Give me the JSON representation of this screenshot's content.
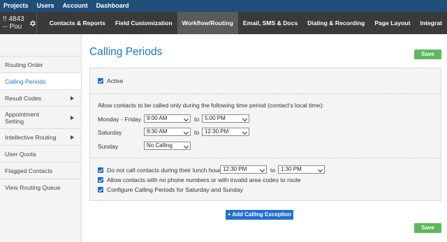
{
  "topnav": {
    "items": [
      "Projects",
      "Users",
      "Account",
      "Dashboard"
    ]
  },
  "account": {
    "label": "!! 4843 -- Pou"
  },
  "tabs": [
    {
      "label": "Contacts & Reports"
    },
    {
      "label": "Field Customization"
    },
    {
      "label": "Workflow/Routing"
    },
    {
      "label": "Email, SMS & Docs"
    },
    {
      "label": "Dialing & Recording"
    },
    {
      "label": "Page Layout"
    },
    {
      "label": "Integrat"
    }
  ],
  "sidebar": {
    "items": [
      {
        "label": "Routing Order"
      },
      {
        "label": "Calling Periods"
      },
      {
        "label": "Result Codes"
      },
      {
        "label": "Appointment Setting"
      },
      {
        "label": "Intellective Routing"
      },
      {
        "label": "User Quota"
      },
      {
        "label": "Flagged Contacts"
      },
      {
        "label": "View Routing Queue"
      }
    ]
  },
  "page": {
    "title": "Calling Periods",
    "save_label": "Save"
  },
  "form": {
    "active_label": "Active",
    "period_intro": "Allow contacts to be called only during the following time period (contact's local time):",
    "to_label": "to",
    "rows": [
      {
        "label": "Monday - Friday",
        "from": "9:00 AM",
        "to": "5:00 PM"
      },
      {
        "label": "Saturday",
        "from": "9:30 AM",
        "to": "12:30 PM"
      },
      {
        "label": "Sunday",
        "from": "No Calling"
      }
    ],
    "lunch_label": "Do not call contacts during their lunch hour",
    "lunch_from": "12:30 PM",
    "lunch_to": "1:30 PM",
    "no_phone_label": "Allow contacts with no phone numbers or with invalid area codes to route",
    "configure_label": "Configure Calling Periods for Saturday and Sunday"
  },
  "add_exception_label": "+ Add Calling Exception",
  "colors": {
    "accent": "#1a73c9",
    "save": "#5cb85c",
    "topnav": "#1f4e79",
    "subnav": "#3a3a3a"
  }
}
